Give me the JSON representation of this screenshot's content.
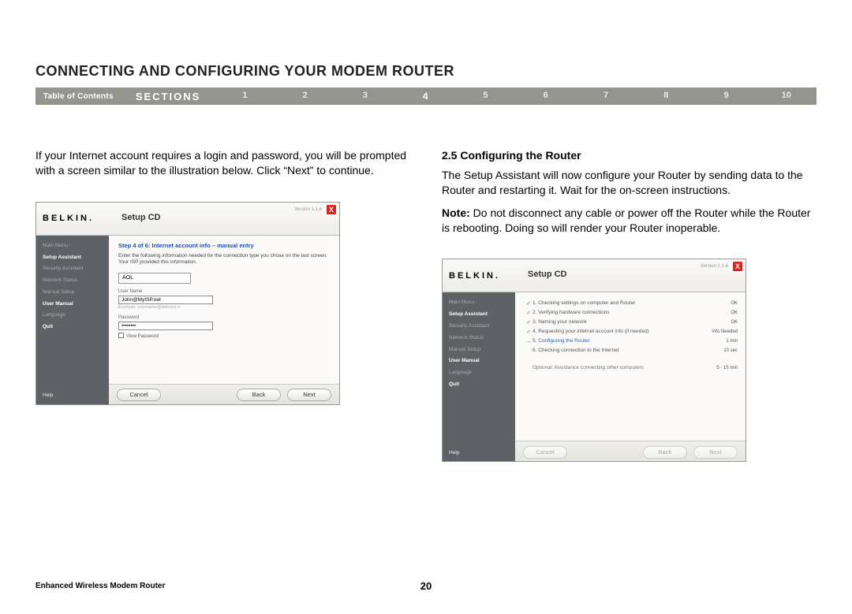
{
  "page_title": "CONNECTING AND CONFIGURING YOUR MODEM ROUTER",
  "nav": {
    "toc": "Table of Contents",
    "sections": "SECTIONS",
    "numbers": [
      "1",
      "2",
      "3",
      "4",
      "5",
      "6",
      "7",
      "8",
      "9",
      "10"
    ],
    "current": "4"
  },
  "left_col": {
    "para": "If your Internet account requires a login and password, you will be prompted with a screen similar to the illustration below. Click “Next” to continue."
  },
  "right_col": {
    "heading": "2.5 Configuring the Router",
    "para": "The Setup Assistant will now configure your Router by sending data to the Router and restarting it. Wait for the on-screen instructions.",
    "note_label": "Note:",
    "note_body": " Do not disconnect any cable or power off the Router while the Router is rebooting. Doing so will render your Router inoperable."
  },
  "wizard_common": {
    "logo": "BELKIN.",
    "header_title": "Setup CD",
    "version": "Version 1.1.6",
    "close": "X",
    "menu": {
      "main_menu": "Main Menu",
      "setup_assistant": "Setup Assistant",
      "security_assistant": "Security Assistant",
      "network_status": "Network Status",
      "manual_setup": "Manual Setup",
      "user_manual": "User Manual",
      "language": "Language",
      "quit": "Quit"
    },
    "help": "Help",
    "btn_cancel": "Cancel",
    "btn_back": "Back",
    "btn_next": "Next"
  },
  "wizard_left": {
    "step_title": "Step 4 of 6: Internet account info – manual entry",
    "desc": "Enter the following information needed for the connection type you chose on the last screen. Your ISP provided this information.",
    "isp": "AOL",
    "user_label": "User Name",
    "user_value": "John@MyISP.net",
    "user_hint": "Example: username@telenyst.rr",
    "pass_label": "Password",
    "pass_value": "••••••••",
    "viewpw": "View Password"
  },
  "wizard_right": {
    "steps": [
      {
        "ic": "✓",
        "txt": "1. Checking settings on computer and Router",
        "stat": "OK"
      },
      {
        "ic": "✓",
        "txt": "2. Verifying hardware connections",
        "stat": "OK"
      },
      {
        "ic": "✓",
        "txt": "3. Naming your network",
        "stat": "OK"
      },
      {
        "ic": "✓",
        "txt": "4. Requesting your internet account info (if needed)",
        "stat": "Info Needed"
      },
      {
        "ic": "→",
        "txt": "5. Configuring the Router",
        "stat": "1 min",
        "active": "1"
      },
      {
        "ic": "",
        "txt": "6. Checking connection to the Internet",
        "stat": "10 sec"
      }
    ],
    "optional": "Optional: Assistance connecting other computers",
    "optional_stat": "5 - 15 min"
  },
  "footer": {
    "product": "Enhanced Wireless Modem Router",
    "page_num": "20"
  }
}
